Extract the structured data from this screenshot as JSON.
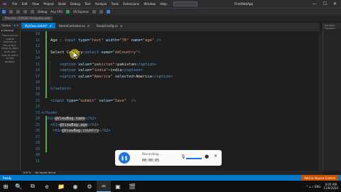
{
  "menubar": {
    "items": [
      "File",
      "Edit",
      "View",
      "Project",
      "Build",
      "Debug",
      "Test",
      "Analyze",
      "Tools",
      "Extensions",
      "Window",
      "Help"
    ],
    "app_name": "FirstWebApp",
    "controls": [
      "—",
      "☐",
      "✕"
    ]
  },
  "toolbar": {
    "config": "Debug",
    "platform": "Any CPU",
    "run_label": "IIS Express",
    "process": "Process: [10636] iisexpress.exe"
  },
  "toolbox": {
    "title": "Toolbox",
    "pin": "▾ ✕",
    "subtitle": "▸ General",
    "message": "There are no usable controls in this group. Drag an item onto this text to add it to the toolbox."
  },
  "tabs": [
    {
      "label": "MyView.cshtml*",
      "active": true
    },
    {
      "label": "HomeController.cs",
      "active": false
    },
    {
      "label": "RouteConfig.cs",
      "active": false
    }
  ],
  "editor": {
    "lines": [
      {
        "num": "10",
        "parts": []
      },
      {
        "num": "11",
        "parts": [
          {
            "t": "    Age ",
            "c": "c-text"
          },
          {
            "t": ": ",
            "c": "c-text"
          },
          {
            "t": "input ",
            "c": "c-tag"
          },
          {
            "t": "type",
            "c": "c-attr"
          },
          {
            "t": "=",
            "c": "c-text"
          },
          {
            "t": "\"text\" ",
            "c": "c-val"
          },
          {
            "t": "width",
            "c": "c-attr"
          },
          {
            "t": "=",
            "c": "c-text"
          },
          {
            "t": "\"70\" ",
            "c": "c-val"
          },
          {
            "t": "name",
            "c": "c-attr"
          },
          {
            "t": "=",
            "c": "c-text"
          },
          {
            "t": "\"age\" ",
            "c": "c-val"
          },
          {
            "t": "/>",
            "c": "c-tag"
          }
        ]
      },
      {
        "num": "12",
        "parts": []
      },
      {
        "num": "13",
        "parts": [
          {
            "t": "    Select Country:",
            "c": "c-text"
          },
          {
            "t": "select ",
            "c": "c-tag"
          },
          {
            "t": "name",
            "c": "c-attr"
          },
          {
            "t": "=",
            "c": "c-text"
          },
          {
            "t": "\"ddCountry\"",
            "c": "c-val"
          },
          {
            "t": ">",
            "c": "c-tag"
          }
        ]
      },
      {
        "num": "14",
        "parts": []
      },
      {
        "num": "15",
        "parts": [
          {
            "t": "        <option ",
            "c": "c-tag"
          },
          {
            "t": "value",
            "c": "c-attr"
          },
          {
            "t": "=",
            "c": "c-text"
          },
          {
            "t": "\"pakistan\"",
            "c": "c-val"
          },
          {
            "t": ">",
            "c": "c-tag"
          },
          {
            "t": "pakistan",
            "c": "c-text"
          },
          {
            "t": "</option>",
            "c": "c-tag"
          }
        ]
      },
      {
        "num": "16",
        "parts": [
          {
            "t": "        <option ",
            "c": "c-tag"
          },
          {
            "t": "value",
            "c": "c-attr"
          },
          {
            "t": "=",
            "c": "c-text"
          },
          {
            "t": "\"india\"",
            "c": "c-val"
          },
          {
            "t": ">",
            "c": "c-tag"
          },
          {
            "t": "india",
            "c": "c-text"
          },
          {
            "t": "</option>",
            "c": "c-tag"
          }
        ]
      },
      {
        "num": "17",
        "parts": [
          {
            "t": "        <option ",
            "c": "c-tag"
          },
          {
            "t": "value",
            "c": "c-attr"
          },
          {
            "t": "=",
            "c": "c-text"
          },
          {
            "t": "\"America\" ",
            "c": "c-val"
          },
          {
            "t": "selected",
            "c": "c-attr"
          },
          {
            "t": ">",
            "c": "c-tag"
          },
          {
            "t": "America",
            "c": "c-text"
          },
          {
            "t": "</option>",
            "c": "c-tag"
          }
        ]
      },
      {
        "num": "18",
        "parts": []
      },
      {
        "num": "19",
        "parts": [
          {
            "t": "    </select>",
            "c": "c-tag"
          }
        ]
      },
      {
        "num": "20",
        "parts": []
      },
      {
        "num": "21",
        "parts": [
          {
            "t": "    <input ",
            "c": "c-tag"
          },
          {
            "t": "type",
            "c": "c-attr"
          },
          {
            "t": "=",
            "c": "c-text"
          },
          {
            "t": "\"submit\" ",
            "c": "c-val"
          },
          {
            "t": "value",
            "c": "c-attr"
          },
          {
            "t": "=",
            "c": "c-text"
          },
          {
            "t": "\"Save\"  ",
            "c": "c-val"
          },
          {
            "t": "/>",
            "c": "c-tag"
          }
        ]
      },
      {
        "num": "22",
        "parts": []
      },
      {
        "num": "23",
        "parts": [
          {
            "t": "</form>",
            "c": "c-tag"
          }
        ]
      },
      {
        "num": "24",
        "parts": [
          {
            "t": "  <h2>",
            "c": "c-tag"
          },
          {
            "t": "@ViewBag.name",
            "c": "c-razor"
          },
          {
            "t": "</h2>",
            "c": "c-tag"
          }
        ]
      },
      {
        "num": "25",
        "parts": [
          {
            "t": "    <h1>",
            "c": "c-tag"
          },
          {
            "t": "@ViewBag.age",
            "c": "c-razor"
          },
          {
            "t": "</h2>",
            "c": "c-tag"
          }
        ]
      },
      {
        "num": "26",
        "parts": [
          {
            "t": "     <h1>",
            "c": "c-tag"
          },
          {
            "t": "@ViewBag.country",
            "c": "c-razor"
          },
          {
            "t": "</h2>",
            "c": "c-tag"
          }
        ]
      },
      {
        "num": "27",
        "parts": []
      },
      {
        "num": "28",
        "parts": []
      },
      {
        "num": "29",
        "parts": []
      },
      {
        "num": "30",
        "parts": []
      },
      {
        "num": "31",
        "parts": []
      }
    ]
  },
  "recorder": {
    "label": "Recording...",
    "time": "00:00:05",
    "stop_glyph": "❚❚",
    "mic": "🎙",
    "cam": "●",
    "close": "✕"
  },
  "editor_status": {
    "zoom": "100 %",
    "issues": "No issues found"
  },
  "vs_status": {
    "left": "Ready",
    "right": "Add to Source Control"
  },
  "right_panel": {
    "title": "Solution Explorer"
  },
  "taskbar": {
    "icons": [
      "🔍",
      "⧉",
      "e",
      "📁",
      "◉",
      "⚙",
      "∞",
      "▣",
      "🎬"
    ],
    "tray": "^ ⌂ ♪ ENG",
    "time": "9:05 AM",
    "date": "11/9/2020"
  },
  "colors": {
    "accent": "#007acc",
    "tag": "#569cd6",
    "attr": "#9cdcfe",
    "string": "#d69d85",
    "line_num": "#2b91af",
    "change_bar": "#57a64a"
  }
}
